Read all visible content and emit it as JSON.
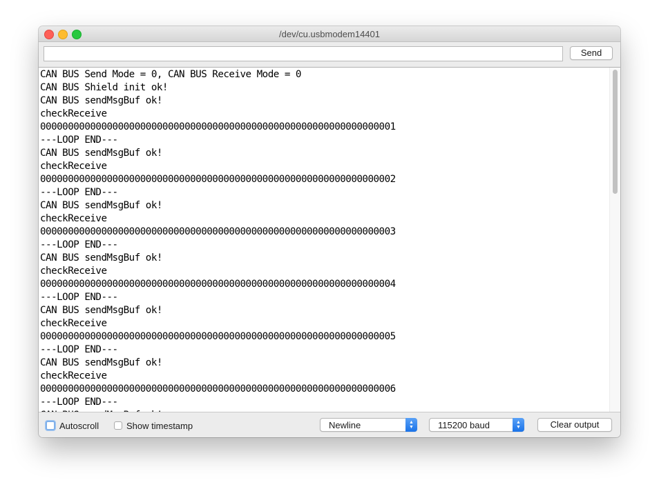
{
  "window": {
    "title": "/dev/cu.usbmodem14401"
  },
  "toolbar": {
    "input_value": "",
    "send_label": "Send"
  },
  "output": {
    "lines": [
      "CAN BUS Send Mode = 0, CAN BUS Receive Mode = 0",
      "CAN BUS Shield init ok!",
      "CAN BUS sendMsgBuf ok!",
      "checkReceive",
      "0000000000000000000000000000000000000000000000000000000000000001",
      "---LOOP END---",
      "CAN BUS sendMsgBuf ok!",
      "checkReceive",
      "0000000000000000000000000000000000000000000000000000000000000002",
      "---LOOP END---",
      "CAN BUS sendMsgBuf ok!",
      "checkReceive",
      "0000000000000000000000000000000000000000000000000000000000000003",
      "---LOOP END---",
      "CAN BUS sendMsgBuf ok!",
      "checkReceive",
      "0000000000000000000000000000000000000000000000000000000000000004",
      "---LOOP END---",
      "CAN BUS sendMsgBuf ok!",
      "checkReceive",
      "0000000000000000000000000000000000000000000000000000000000000005",
      "---LOOP END---",
      "CAN BUS sendMsgBuf ok!",
      "checkReceive",
      "0000000000000000000000000000000000000000000000000000000000000006",
      "---LOOP END---",
      "CAN BUS sendMsgBuf ok!"
    ]
  },
  "bottom": {
    "autoscroll_label": "Autoscroll",
    "autoscroll_checked": false,
    "timestamp_label": "Show timestamp",
    "timestamp_checked": false,
    "line_ending": "Newline",
    "baud": "115200 baud",
    "clear_label": "Clear output"
  },
  "icons": {
    "close": "close-icon",
    "minimize": "minimize-icon",
    "maximize": "maximize-icon",
    "select_arrows": "chevron-updown-icon"
  },
  "colors": {
    "close": "#fe5f57",
    "minimize": "#febc2e",
    "maximize": "#28c840",
    "accent": "#1a73e8"
  }
}
